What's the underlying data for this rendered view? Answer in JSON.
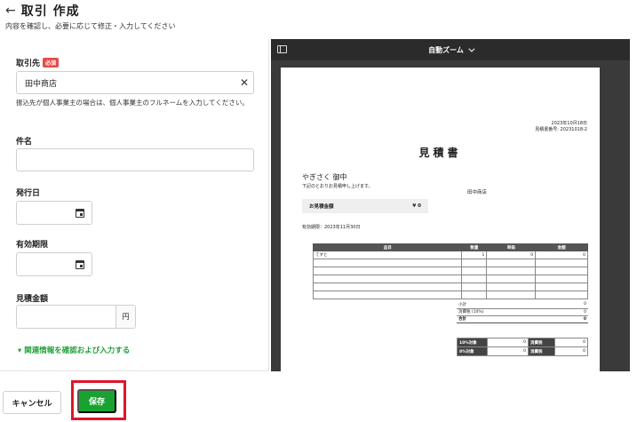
{
  "header": {
    "title": "取引 作成",
    "subtitle": "内容を確認し、必要に応じて修正・入力してください"
  },
  "form": {
    "partner": {
      "label": "取引先",
      "required_badge": "必須",
      "value": "田中商店",
      "hint": "振込先が個人事業主の場合は、個人事業主のフルネームを入力してください。"
    },
    "subject": {
      "label": "件名",
      "value": ""
    },
    "issue_date": {
      "label": "発行日",
      "value": ""
    },
    "expiry": {
      "label": "有効期限",
      "value": ""
    },
    "amount": {
      "label": "見積金額",
      "value": "",
      "unit": "円"
    },
    "related_link": "▾ 関連情報を確認および入力する"
  },
  "preview": {
    "zoom_label": "自動ズーム",
    "document": {
      "date": "2023年10月18日",
      "number": "見積書番号: 20231018-2",
      "title": "見積書",
      "client": "やぎさく 御中",
      "intro": "下記のとおりお見積申し上げます。",
      "issuer": "田中商店",
      "amount_label": "お見積金額",
      "amount_value": "¥ 0",
      "validity": "有効期限：2023年11月30日",
      "table_headers": [
        "品目",
        "数量",
        "単価",
        "金額"
      ],
      "items": [
        {
          "name": "てすと",
          "qty": "1",
          "price": "0",
          "amount": "0"
        }
      ],
      "summary": [
        {
          "label": "小計",
          "value": "0"
        },
        {
          "label": "消費税 (10%)",
          "value": "0"
        },
        {
          "label": "合計",
          "value": "0"
        }
      ],
      "tax_rows": [
        {
          "label": "10%対象",
          "value": "0",
          "tax_label": "消費税",
          "tax_value": "0"
        },
        {
          "label": "8%対象",
          "value": "0",
          "tax_label": "消費税",
          "tax_value": "0"
        }
      ]
    }
  },
  "footer": {
    "cancel_label": "キャンセル",
    "save_label": "保存"
  },
  "colors": {
    "primary": "#18a331",
    "required": "#e64b4b",
    "highlight": "#e0142a",
    "link": "#22a13a"
  }
}
